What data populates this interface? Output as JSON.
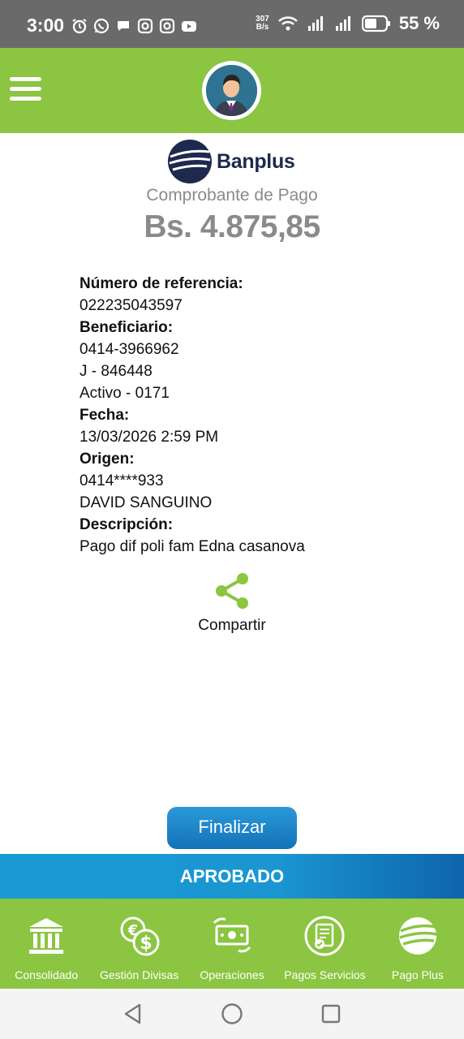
{
  "status_bar": {
    "time": "3:00",
    "net_speed_top": "307",
    "net_speed_bottom": "B/s",
    "battery": "55 %",
    "icons_left": [
      "alarm-icon",
      "whatsapp-icon",
      "chat-icon",
      "instagram-icon",
      "instagram-icon",
      "youtube-icon"
    ],
    "icons_right": [
      "wifi-icon",
      "signal-icon",
      "signal-icon",
      "battery-icon"
    ]
  },
  "header": {
    "menu_icon": "hamburger-icon",
    "avatar_icon": "user-avatar"
  },
  "colors": {
    "brand_green": "#8bc541",
    "brand_blue": "#1a96d2",
    "text_gray": "#8a8a8a"
  },
  "logo": {
    "text": "Banplus"
  },
  "receipt": {
    "title": "Comprobante de Pago",
    "amount": "Bs. 4.875,85",
    "reference_label": "Número de referencia:",
    "reference_value": "022235043597",
    "beneficiary_label": "Beneficiario:",
    "beneficiary_phone": "0414-3966962",
    "beneficiary_id": "J - 846448",
    "beneficiary_bank": "Activo - 0171",
    "date_label": "Fecha:",
    "date_value": "13/03/2026 2:59 PM",
    "origin_label": "Origen:",
    "origin_phone": "0414****933",
    "origin_name": "DAVID SANGUINO",
    "description_label": "Descripción:",
    "description_value": "Pago dif poli fam Edna casanova"
  },
  "share": {
    "label": "Compartir",
    "icon": "share-icon"
  },
  "finalize_button": "Finalizar",
  "status_banner": "APROBADO",
  "bottom_nav": [
    {
      "label": "Consolidado",
      "icon": "bank-icon"
    },
    {
      "label": "Gestión Divisas",
      "icon": "currency-exchange-icon"
    },
    {
      "label": "Operaciones",
      "icon": "money-transfer-icon"
    },
    {
      "label": "Pagos Servicios",
      "icon": "bill-payment-icon"
    },
    {
      "label": "Pago Plus",
      "icon": "pago-plus-icon"
    }
  ],
  "system_nav": [
    "back-icon",
    "home-icon",
    "recents-icon"
  ]
}
